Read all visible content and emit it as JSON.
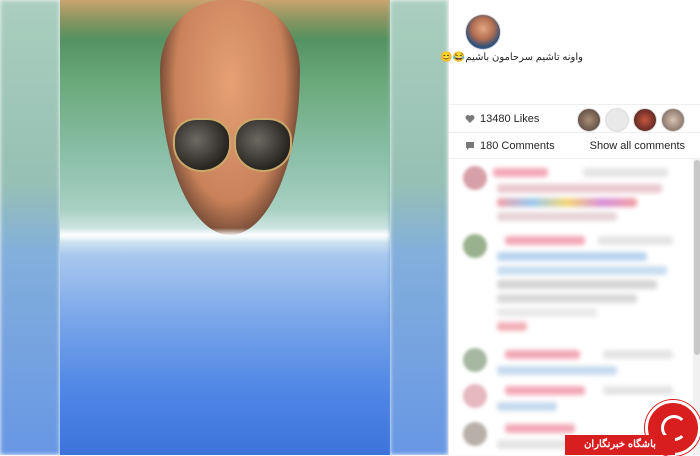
{
  "post": {
    "caption": "واونه تاشیم سرحامون باشیم😂😊",
    "likes": "13480 Likes",
    "comments": "180 Comments",
    "show_all_label": "Show all comments"
  },
  "icons": {
    "heart": "heart-icon",
    "comment": "comment-icon"
  },
  "watermark": {
    "brand_text": "باشگاه خبرنگاران"
  },
  "colors": {
    "brand_red": "#d81e1e",
    "text": "#262626"
  }
}
